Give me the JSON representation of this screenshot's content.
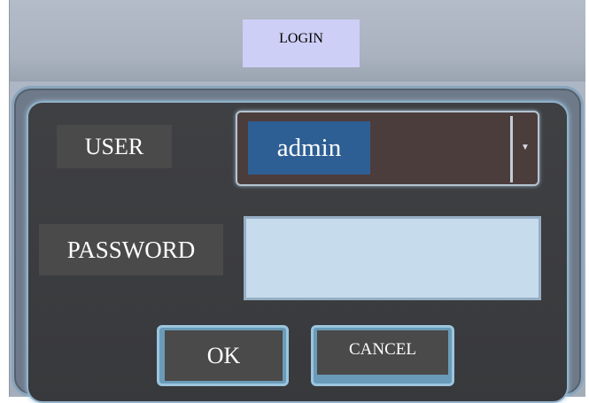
{
  "dialog": {
    "title": "LOGIN"
  },
  "form": {
    "user_label": "USER",
    "user_value": "admin",
    "password_label": "PASSWORD",
    "password_value": ""
  },
  "buttons": {
    "ok_label": "OK",
    "cancel_label": "CANCEL"
  },
  "icons": {
    "dropdown": "chevron-down-icon"
  },
  "colors": {
    "title_bg": "#cecff6",
    "panel_bg": "#3f4043",
    "selected_value_bg": "#2e5f94",
    "password_field_bg": "#c6dbec",
    "button_accent": "#6a9bb8",
    "label_bg": "#4a4a4a"
  }
}
